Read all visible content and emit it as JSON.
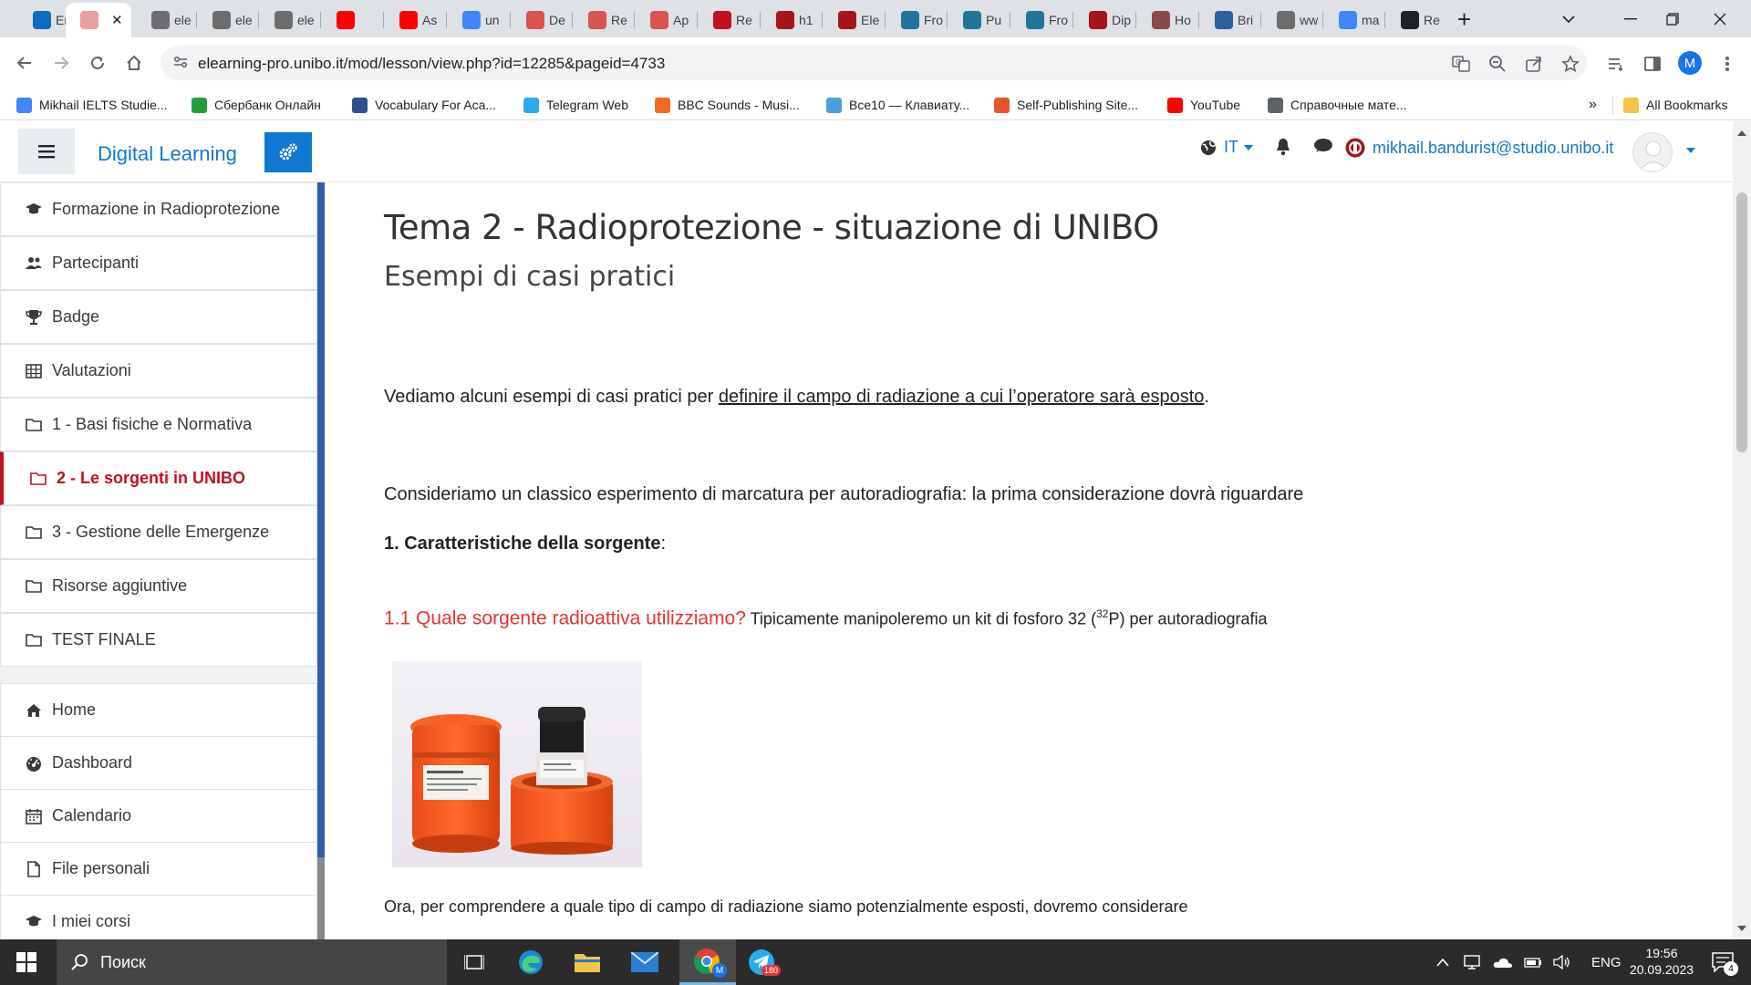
{
  "browser": {
    "tabs": [
      {
        "label": "Em",
        "icon": "outlook-icon",
        "color": "#0f6cbd"
      },
      {
        "label": "",
        "icon": "unibo-icon",
        "color": "#e8a0a0",
        "active": true
      },
      {
        "label": "ele",
        "icon": "globe-icon",
        "color": "#6d6d6d"
      },
      {
        "label": "ele",
        "icon": "globe-icon",
        "color": "#6d6d6d"
      },
      {
        "label": "ele",
        "icon": "globe-icon",
        "color": "#6d6d6d"
      },
      {
        "label": "",
        "icon": "youtube-icon",
        "color": "#ff0000"
      },
      {
        "label": "As",
        "icon": "youtube-icon",
        "color": "#ff0000"
      },
      {
        "label": "un",
        "icon": "google-icon",
        "color": "#4285f4"
      },
      {
        "label": "De",
        "icon": "unibo-icon",
        "color": "#d9534f"
      },
      {
        "label": "Re",
        "icon": "unibo-icon",
        "color": "#d9534f"
      },
      {
        "label": "Ap",
        "icon": "unibo-icon",
        "color": "#d9534f"
      },
      {
        "label": "Re",
        "icon": "slash-icon",
        "color": "#c1121f"
      },
      {
        "label": "h1",
        "icon": "shield-icon",
        "color": "#a4161a"
      },
      {
        "label": "Ele",
        "icon": "shield-icon",
        "color": "#a4161a"
      },
      {
        "label": "Fro",
        "icon": "wordpress-icon",
        "color": "#21759b"
      },
      {
        "label": "Pu",
        "icon": "wordpress-icon",
        "color": "#21759b"
      },
      {
        "label": "Fro",
        "icon": "wordpress-icon",
        "color": "#21759b"
      },
      {
        "label": "Dip",
        "icon": "shield-icon",
        "color": "#a4161a"
      },
      {
        "label": "Ho",
        "icon": "unibo-icon",
        "color": "#8b4a4a"
      },
      {
        "label": "Bri",
        "icon": "document-icon",
        "color": "#2c5f9e"
      },
      {
        "label": "ww",
        "icon": "globe-icon",
        "color": "#6d6d6d"
      },
      {
        "label": "ma",
        "icon": "google-icon",
        "color": "#4285f4"
      },
      {
        "label": "Re",
        "icon": "r6-icon",
        "color": "#202124"
      }
    ],
    "url": "elearning-pro.unibo.it/mod/lesson/view.php?id=12285&pageid=4733",
    "profile_initial": "M",
    "bookmarks": [
      {
        "label": "Mikhail IELTS Studie...",
        "icon": "doc-icon",
        "color": "#4285f4"
      },
      {
        "label": "Сбербанк Онлайн",
        "icon": "check-circle-icon",
        "color": "#21a038"
      },
      {
        "label": "Vocabulary For Aca...",
        "icon": "ielts-icon",
        "color": "#2f4f8f"
      },
      {
        "label": "Telegram Web",
        "icon": "telegram-icon",
        "color": "#2aabee"
      },
      {
        "label": "BBC Sounds - Musi...",
        "icon": "bbc-icon",
        "color": "#f26b21"
      },
      {
        "label": "Все10 — Клавиату...",
        "icon": "keyboard-icon",
        "color": "#4a9fe0"
      },
      {
        "label": "Self-Publishing Site...",
        "icon": "p-icon",
        "color": "#e8552a"
      },
      {
        "label": "YouTube",
        "icon": "youtube-icon",
        "color": "#ff0000"
      },
      {
        "label": "Справочные мате...",
        "icon": "globe-icon",
        "color": "#5f6368"
      }
    ],
    "bookmarks_more": "»",
    "all_bookmarks": "All Bookmarks"
  },
  "moodle": {
    "site_name": "Digital Learning",
    "language": "IT",
    "user_email": "mikhail.bandurist@studio.unibo.it",
    "nav": [
      {
        "label": "Formazione in Radioprotezione",
        "icon": "graduation-cap-icon"
      },
      {
        "label": "Partecipanti",
        "icon": "users-icon"
      },
      {
        "label": "Badge",
        "icon": "trophy-icon"
      },
      {
        "label": "Valutazioni",
        "icon": "table-icon"
      },
      {
        "label": "1 - Basi fisiche e Normativa",
        "icon": "folder-icon"
      },
      {
        "label": "2 - Le sorgenti in UNIBO",
        "icon": "folder-icon",
        "active": true
      },
      {
        "label": "3 - Gestione delle Emergenze",
        "icon": "folder-icon"
      },
      {
        "label": "Risorse aggiuntive",
        "icon": "folder-icon"
      },
      {
        "label": "TEST FINALE",
        "icon": "folder-icon"
      }
    ],
    "nav2": [
      {
        "label": "Home",
        "icon": "home-icon"
      },
      {
        "label": "Dashboard",
        "icon": "dashboard-icon"
      },
      {
        "label": "Calendario",
        "icon": "calendar-icon"
      },
      {
        "label": "File personali",
        "icon": "file-icon"
      },
      {
        "label": "I miei corsi",
        "icon": "graduation-cap-icon"
      }
    ]
  },
  "page": {
    "title": "Tema 2 - Radioprotezione - situazione di UNIBO",
    "subtitle": "Esempi di casi pratici",
    "p1_prefix": "Vediamo alcuni esempi di casi pratici per ",
    "p1_link": "definire il campo di radiazione a cui l’operatore sarà esposto",
    "p1_suffix": ".",
    "p2": "Consideriamo un classico esperimento di marcatura per autoradiografia: la prima considerazione dovrà riguardare",
    "h3": "1. Caratteristiche della sorgente",
    "h3_suffix": ":",
    "q1_red": "1.1 Quale sorgente radioattiva utilizziamo?",
    "q1_text": " Tipicamente manipoleremo un kit di fosforo 32 (",
    "q1_sup": "32",
    "q1_end": "P) per autoradiografia",
    "p3": "Ora, per comprendere a quale tipo di campo di radiazione siamo potenzialmente esposti, dovremo considerare"
  },
  "taskbar": {
    "search_placeholder": "Поиск",
    "telegram_badge": "180",
    "chrome_badge": "M",
    "language": "ENG",
    "time": "19:56",
    "date": "20.09.2023",
    "notifications": "4"
  }
}
